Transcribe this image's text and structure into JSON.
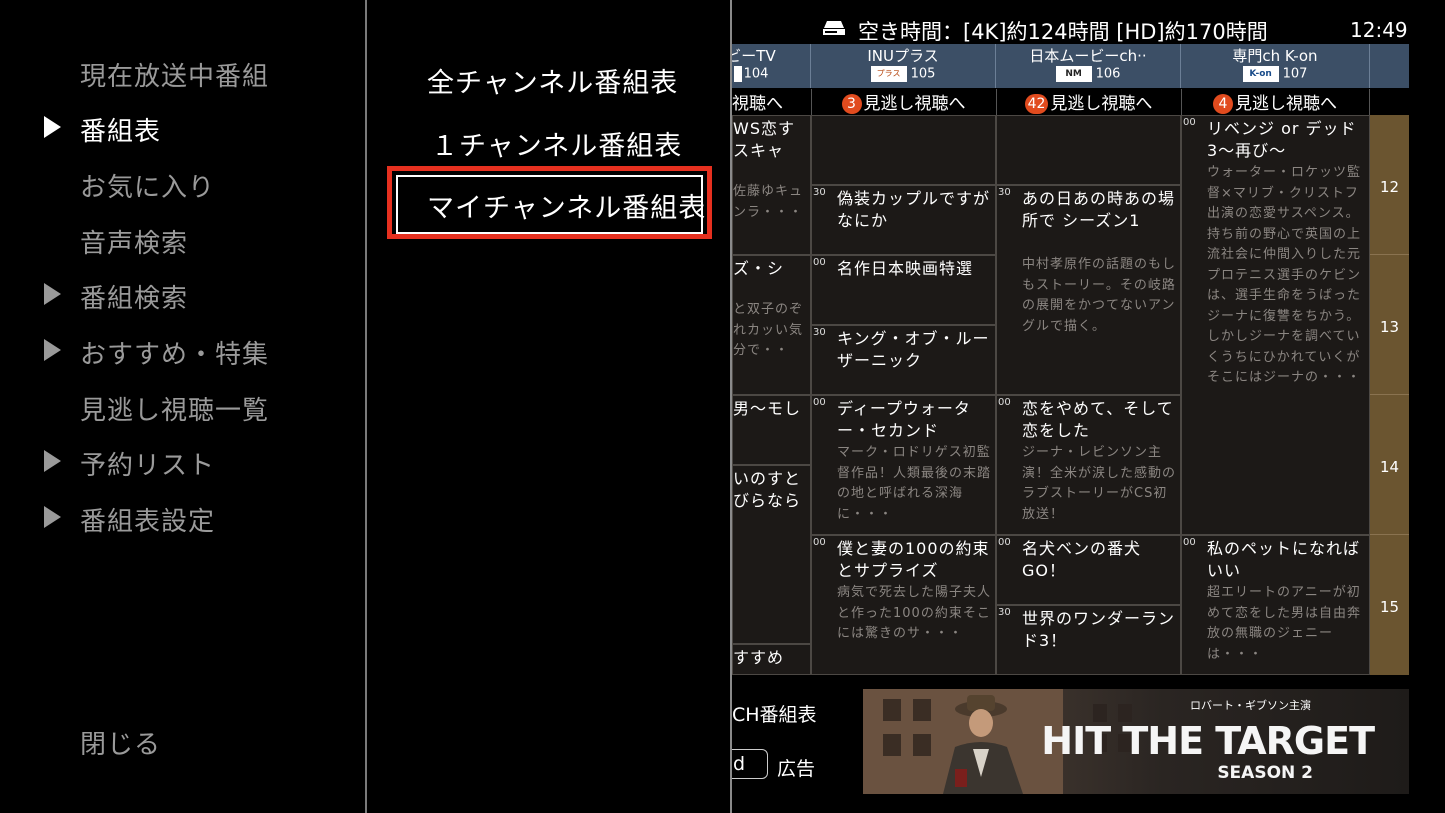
{
  "left_menu": {
    "items": [
      {
        "label": "現在放送中番組",
        "has_arrow": false,
        "active": false
      },
      {
        "label": "番組表",
        "has_arrow": true,
        "active": true
      },
      {
        "label": "お気に入り",
        "has_arrow": false,
        "active": false
      },
      {
        "label": "音声検索",
        "has_arrow": false,
        "active": false
      },
      {
        "label": "番組検索",
        "has_arrow": true,
        "active": false
      },
      {
        "label": "おすすめ・特集",
        "has_arrow": true,
        "active": false
      },
      {
        "label": "見逃し視聴一覧",
        "has_arrow": false,
        "active": false
      },
      {
        "label": "予約リスト",
        "has_arrow": true,
        "active": false
      },
      {
        "label": "番組表設定",
        "has_arrow": true,
        "active": false
      }
    ],
    "close_label": "閉じる"
  },
  "sub_menu": {
    "items": [
      "全チャンネル番組表",
      "１チャンネル番組表",
      "マイチャンネル番組表"
    ],
    "selected_index": 2
  },
  "epg": {
    "status": "空き時間：[4K]約124時間 [HD]約170時間",
    "clock": "12:49",
    "channels": [
      {
        "name": "ビーTV",
        "number": "104",
        "logo": ""
      },
      {
        "name": "INUプラス",
        "number": "105",
        "logo": "プラス"
      },
      {
        "name": "日本ムービーch··",
        "number": "106",
        "logo": "NM"
      },
      {
        "name": "専門ch K-on",
        "number": "107",
        "logo": "K-on"
      }
    ],
    "missed": [
      {
        "count": "",
        "label": "視聴へ"
      },
      {
        "count": "3",
        "label": "見逃し視聴へ"
      },
      {
        "count": "42",
        "label": "見逃し視聴へ"
      },
      {
        "count": "4",
        "label": "見逃し視聴へ"
      }
    ],
    "hours": [
      "12",
      "13",
      "14",
      "15"
    ],
    "programs": {
      "c0a": {
        "min": "",
        "title": "WS恋すスキャ",
        "desc": "佐藤ゆキュンラ・・・"
      },
      "c0b": {
        "min": "",
        "title": "ズ・シ",
        "desc": "と双子のぞれカッい気分で・・"
      },
      "c0c": {
        "min": "",
        "title": "男〜モし",
        "desc": ""
      },
      "c0d": {
        "min": "",
        "title": "いのすとびらなら",
        "desc": ""
      },
      "c0e": {
        "min": "",
        "title": "すすめ",
        "desc": ""
      },
      "c1a": {
        "min": "",
        "title": "",
        "desc": ""
      },
      "c1b": {
        "min": "30",
        "title": "偽装カップルですがなにか",
        "desc": ""
      },
      "c1c": {
        "min": "00",
        "title": "名作日本映画特選",
        "desc": ""
      },
      "c1d": {
        "min": "30",
        "title": "キング・オブ・ルーザーニック",
        "desc": ""
      },
      "c1e": {
        "min": "00",
        "title": "ディープウォーター・セカンド",
        "desc": "マーク・ロドリゲス初監督作品！人類最後の末踏の地と呼ばれる深海に・・・"
      },
      "c1f": {
        "min": "00",
        "title": "僕と妻の100の約束とサプライズ",
        "desc": "病気で死去した陽子夫人と作った100の約束そこには驚きのサ・・・"
      },
      "c2a": {
        "min": "",
        "title": "",
        "desc": ""
      },
      "c2b": {
        "min": "30",
        "title": "あの日あの時あの場所で シーズン1",
        "desc": "中村孝原作の話題のもしもストーリー。その岐路の展開をかつてないアングルで描く。"
      },
      "c2c": {
        "min": "00",
        "title": "恋をやめて、そして恋をした",
        "desc": "ジーナ・レビンソン主演！全米が涙した感動のラブストーリーがCS初放送！"
      },
      "c2d": {
        "min": "00",
        "title": "名犬ベンの番犬GO！",
        "desc": ""
      },
      "c2e": {
        "min": "30",
        "title": "世界のワンダーランド3！",
        "desc": ""
      },
      "c3a": {
        "min": "00",
        "title": "リベンジ or デッド3〜再び〜",
        "desc": "ウォーター・ロケッツ監督×マリブ・クリストフ出演の恋愛サスペンス。持ち前の野心で英国の上流社会に仲間入りした元プロテニス選手のケビンは、選手生命をうばったジーナに復讐をちかう。しかしジーナを調べていくうちにひかれていくがそこにはジーナの・・・"
      },
      "c3b": {
        "min": "00",
        "title": "私のペットになればいい",
        "desc": "超エリートのアニーが初めて恋をした男は自由奔放の無職のジェニーは・・・"
      }
    },
    "bottom_left": "CH番組表",
    "d_button": "d",
    "ad_label": "広告",
    "ad": {
      "subtitle": "ロバート・ギブソン主演",
      "title": "HIT THE TARGET",
      "season": "SEASON 2"
    }
  }
}
